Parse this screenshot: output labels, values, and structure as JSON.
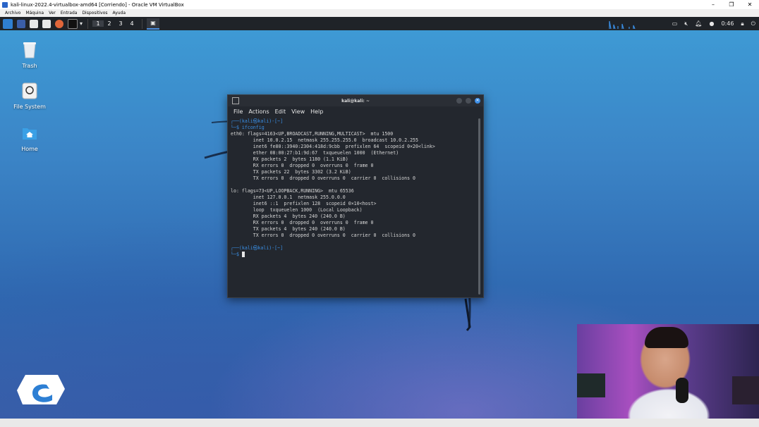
{
  "host": {
    "window_title": "kali-linux-2022.4-virtualbox-amd64 [Corriendo] - Oracle VM VirtualBox",
    "menu": [
      "Archivo",
      "Máquina",
      "Ver",
      "Entrada",
      "Dispositivos",
      "Ayuda"
    ],
    "buttons": {
      "minimize": "–",
      "maximize": "❐",
      "close": "✕"
    }
  },
  "panel": {
    "workspaces": [
      "1",
      "2",
      "3",
      "4"
    ],
    "clock": "0:46"
  },
  "desktop": {
    "icons": [
      {
        "label": "Trash"
      },
      {
        "label": "File System"
      },
      {
        "label": "Home"
      }
    ]
  },
  "terminal": {
    "title": "kali@kali: ~",
    "menu": [
      "File",
      "Actions",
      "Edit",
      "View",
      "Help"
    ],
    "close_glyph": "✕",
    "prompt1_user": "(kali㉿kali)-[~]",
    "prompt_frame_top": "┌──",
    "prompt_frame_bottom": "└─",
    "prompt_dollar": "$",
    "command": "ifconfig",
    "output": [
      "eth0: flags=4163<UP,BROADCAST,RUNNING,MULTICAST>  mtu 1500",
      "        inet 10.0.2.15  netmask 255.255.255.0  broadcast 10.0.2.255",
      "        inet6 fe80::3940:2304:418d:9cbb  prefixlen 64  scopeid 0×20<link>",
      "        ether 08:00:27:b1:9d:67  txqueuelen 1000  (Ethernet)",
      "        RX packets 2  bytes 1180 (1.1 KiB)",
      "        RX errors 0  dropped 0  overruns 0  frame 0",
      "        TX packets 22  bytes 3302 (3.2 KiB)",
      "        TX errors 0  dropped 0 overruns 0  carrier 0  collisions 0",
      "",
      "lo: flags=73<UP,LOOPBACK,RUNNING>  mtu 65536",
      "        inet 127.0.0.1  netmask 255.0.0.0",
      "        inet6 ::1  prefixlen 128  scopeid 0×10<host>",
      "        loop  txqueuelen 1000  (Local Loopback)",
      "        RX packets 4  bytes 240 (240.0 B)",
      "        RX errors 0  dropped 0  overruns 0  frame 0",
      "        TX packets 4  bytes 240 (240.0 B)",
      "        TX errors 0  dropped 0 overruns 0  carrier 0  collisions 0"
    ],
    "prompt2_user": "(kali㉿kali)-[~]"
  },
  "colors": {
    "accent": "#3a8fe6",
    "terminal_bg": "#23272e",
    "panel_bg": "#1f2328"
  }
}
